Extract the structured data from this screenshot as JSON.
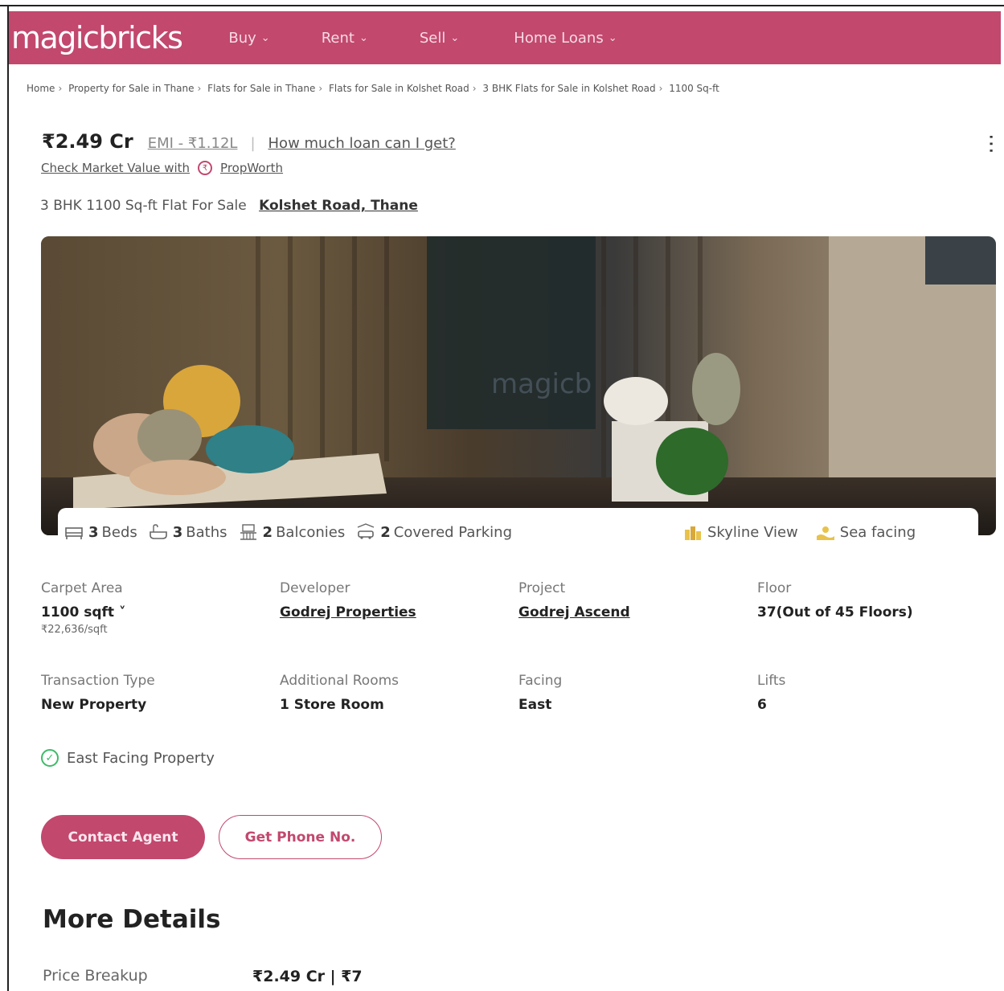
{
  "header": {
    "logo": "magicbricks",
    "nav": [
      {
        "label": "Buy",
        "icon": "chevron-down-icon"
      },
      {
        "label": "Rent",
        "icon": "chevron-down-icon"
      },
      {
        "label": "Sell",
        "icon": "chevron-down-icon"
      },
      {
        "label": "Home Loans",
        "icon": "chevron-down-icon"
      }
    ],
    "brand_color": "#c2486e"
  },
  "breadcrumb": [
    "Home",
    "Property for Sale in Thane",
    "Flats for Sale in Thane",
    "Flats for Sale in Kolshet Road",
    "3 BHK Flats for Sale in Kolshet Road",
    "1100 Sq-ft"
  ],
  "price": {
    "amount": "₹2.49 Cr",
    "emi": "EMI - ₹1.12L",
    "separator": "|",
    "loan_link": "How much loan can I get?",
    "market_value_text": "Check Market Value with",
    "propworth": "PropWorth"
  },
  "listing": {
    "title": "3 BHK 1100 Sq-ft Flat For Sale",
    "location": "Kolshet Road, Thane"
  },
  "amenities": {
    "beds": {
      "count": "3",
      "label": "Beds"
    },
    "baths": {
      "count": "3",
      "label": "Baths"
    },
    "balconies": {
      "count": "2",
      "label": "Balconies"
    },
    "parking": {
      "count": "2",
      "label": "Covered Parking"
    },
    "skyline": "Skyline View",
    "sea": "Sea facing"
  },
  "details": {
    "carpet_area": {
      "label": "Carpet Area",
      "value": "1100 sqft",
      "sub": "₹22,636/sqft"
    },
    "developer": {
      "label": "Developer",
      "value": "Godrej Properties"
    },
    "project": {
      "label": "Project",
      "value": "Godrej Ascend"
    },
    "floor": {
      "label": "Floor",
      "value": "37(Out of 45 Floors)"
    },
    "transaction": {
      "label": "Transaction Type",
      "value": "New Property"
    },
    "additional_rooms": {
      "label": "Additional Rooms",
      "value": "1 Store Room"
    },
    "facing": {
      "label": "Facing",
      "value": "East"
    },
    "lifts": {
      "label": "Lifts",
      "value": "6"
    }
  },
  "feature": "East Facing Property",
  "buttons": {
    "contact": "Contact Agent",
    "phone": "Get Phone No."
  },
  "more_details": {
    "title": "More Details",
    "price_breakup_label": "Price Breakup",
    "price_breakup_value": "₹2.49 Cr | ₹7"
  }
}
